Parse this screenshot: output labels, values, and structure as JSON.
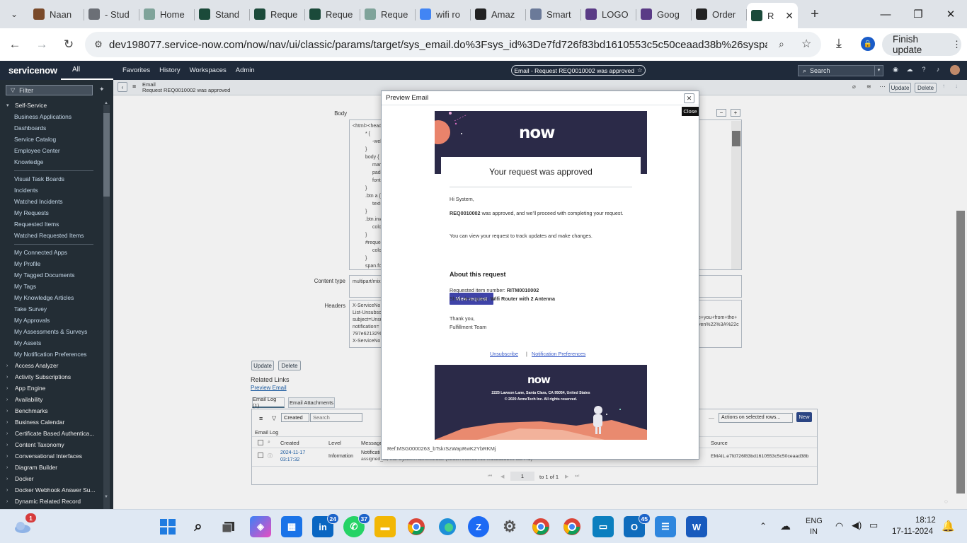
{
  "browser": {
    "tabs": [
      {
        "label": "Naan",
        "fav_color": "#7a4a2a"
      },
      {
        "label": "- Stud",
        "fav_color": "#6b6f76"
      },
      {
        "label": "Home",
        "fav_color": "#7fa39a"
      },
      {
        "label": "Stand",
        "fav_color": "#1b4a3a"
      },
      {
        "label": "Reque",
        "fav_color": "#1b4a3a"
      },
      {
        "label": "Reque",
        "fav_color": "#1b4a3a"
      },
      {
        "label": "Reque",
        "fav_color": "#7fa39a"
      },
      {
        "label": "wifi ro",
        "fav_color": "#4285f4"
      },
      {
        "label": "Amaz",
        "fav_color": "#222222"
      },
      {
        "label": "Smart",
        "fav_color": "#6b7a99"
      },
      {
        "label": "LOGO",
        "fav_color": "#5a3b86"
      },
      {
        "label": "Goog",
        "fav_color": "#5a3b86"
      },
      {
        "label": "Order",
        "fav_color": "#222222"
      },
      {
        "label": "R",
        "fav_color": "#1b4a3a"
      }
    ],
    "url": "dev198077.service-now.com/now/nav/ui/classic/params/target/sys_email.do%3Fsys_id%3De7fd726f83bd1610553c5c50ceaad38b%26sysparm_record...",
    "finish_update": "Finish update"
  },
  "sn": {
    "logo": "servicenow",
    "all": "All",
    "nav": [
      "Favorites",
      "History",
      "Workspaces",
      "Admin"
    ],
    "title_pill": "Email - Request REQ0010002 was approved",
    "search_placeholder": "Search"
  },
  "leftnav": {
    "filter_placeholder": "Filter",
    "section_open": "Self-Service",
    "items": [
      "Business Applications",
      "Dashboards",
      "Service Catalog",
      "Employee Center",
      "Knowledge",
      "|",
      "Visual Task Boards",
      "Incidents",
      "Watched Incidents",
      "My Requests",
      "Requested Items",
      "Watched Requested Items",
      "|",
      "My Connected Apps",
      "My Profile",
      "My Tagged Documents",
      "My Tags",
      "My Knowledge Articles",
      "Take Survey",
      "My Approvals",
      "My Assessments & Surveys",
      "My Assets",
      "My Notification Preferences"
    ],
    "sections": [
      "Access Analyzer",
      "Activity Subscriptions",
      "App Engine",
      "Availability",
      "Benchmarks",
      "Business Calendar",
      "Certificate Based Authentica...",
      "Content Taxonomy",
      "Conversational Interfaces",
      "Diagram Builder",
      "Docker",
      "Docker Webhook Answer Su...",
      "Dynamic Related Record"
    ]
  },
  "form": {
    "crumb_1": "Email",
    "crumb_2": "Request REQ0010002 was approved",
    "update": "Update",
    "delete": "Delete",
    "body_label": "Body",
    "body_lines": [
      "<html><head",
      "* {",
      "-webk",
      "}",
      "body {",
      "margi",
      "paddi",
      "font-f",
      "}",
      ".btn a {",
      "text-d",
      "}",
      ".btn.inver",
      "color:",
      "}",
      "#requesta",
      "color:",
      "}",
      "span.footr"
    ],
    "content_type_label": "Content type",
    "content_type_value": "multipart/mix",
    "headers_label": "Headers",
    "header_lines": [
      "X-ServiceNo",
      "List-Unsubsc",
      "subject=Unsu",
      "notification=",
      "797e62132%",
      "X-ServiceNo"
    ],
    "header_right_1": "e+you+from+the+",
    "header_right_2": "yen%22%3A%22c",
    "related_links": "Related Links",
    "preview_email": "Preview Email",
    "tab_email_log": "Email Log (1)",
    "tab_email_attachments": "Email Attachments",
    "list_sort": "Created",
    "list_search": "Search",
    "actions": "Actions on selected rows...",
    "new": "New",
    "list_title": "Email Log",
    "col_created": "Created",
    "col_level": "Level",
    "col_message": "Message",
    "col_source": "Source",
    "row_created_1": "2024-11-17",
    "row_created_2": "03:17:32",
    "row_level": "Information",
    "row_message_1": "Notificati",
    "row_message_2": "assigned_to, etc: System Administrator (6816f79cc0a8016401c5a33be04be441)",
    "row_source": "EMAIL.e7fd726f83bd1610553c5c50ceaad38b",
    "pager": "1",
    "pager_of": "to 1 of 1"
  },
  "modal": {
    "title": "Preview Email",
    "close_tooltip": "Close",
    "ref": "Ref:MSG0000263_bTskrSzWapRwK2YbRKMj",
    "email": {
      "logo": "now",
      "heading": "Your request was approved",
      "greeting": "Hi System,",
      "req_number": "REQ0010002",
      "approved_text": "was approved, and we'll proceed with completing your request.",
      "track_text": "You can view your request to track updates and make changes.",
      "view_button": "View request",
      "about_heading": "About this request",
      "item_label": "Requested item number:",
      "item_value": "RITM0010002",
      "desc_label": "Short description:",
      "desc_value": "Wifi Router with 2 Antenna",
      "thanks": "Thank you,",
      "team": "Fulfillment Team",
      "unsubscribe": "Unsubscribe",
      "separator": "|",
      "notif_prefs": "Notification Preferences",
      "address": "2225 Lawson Lane, Santa Clara, CA 95054, United States",
      "copyright": "© 2020 AcmeTech Inc. All rights reserved."
    }
  },
  "taskbar": {
    "weather_badge": "1",
    "linkedin_badge": "24",
    "whatsapp_badge": "37",
    "outlook_badge": "45",
    "lang_1": "ENG",
    "lang_2": "IN",
    "time": "18:12",
    "date": "17-11-2024"
  }
}
